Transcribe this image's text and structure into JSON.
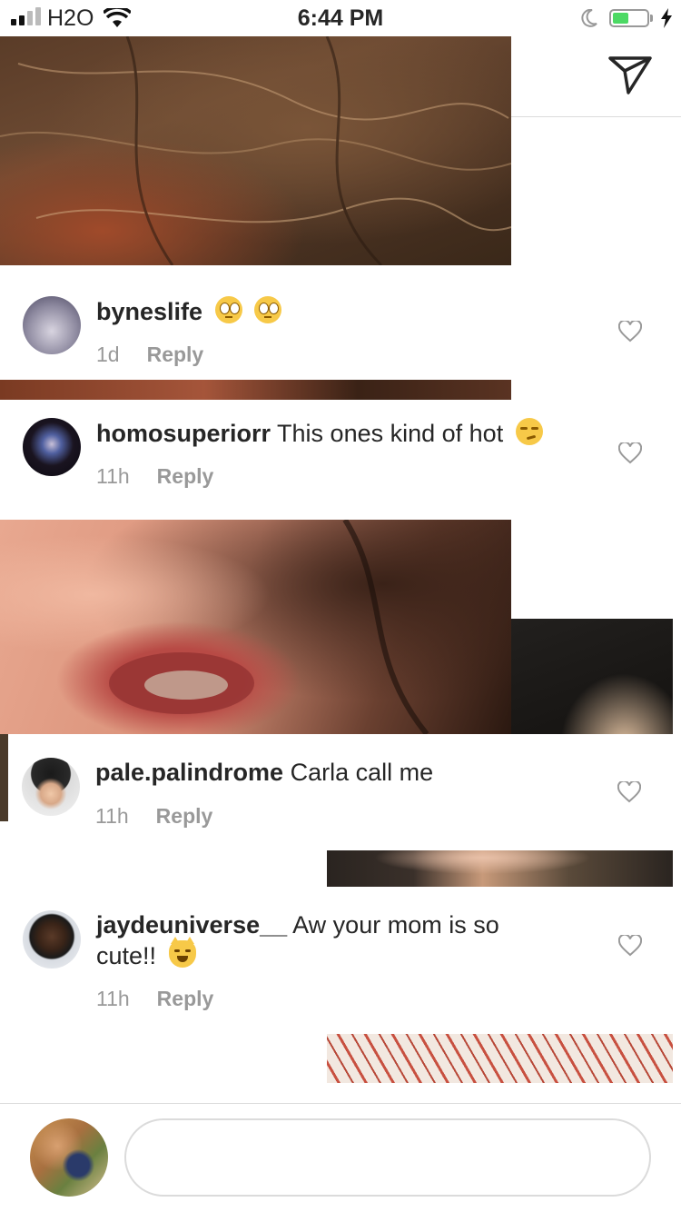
{
  "status_bar": {
    "carrier": "H2O",
    "time": "6:44 PM"
  },
  "comments": [
    {
      "username": "byneslife",
      "text": "",
      "emoji": [
        "rolling-eyes-emoji",
        "rolling-eyes-emoji"
      ],
      "time": "1d",
      "reply_label": "Reply"
    },
    {
      "username": "homosuperiorr",
      "text": "This ones kind of hot",
      "emoji": [
        "smirk-emoji"
      ],
      "time": "11h",
      "reply_label": "Reply"
    },
    {
      "username": "pale.palindrome",
      "text": "Carla call me",
      "emoji": [],
      "time": "11h",
      "reply_label": "Reply"
    },
    {
      "username": "jaydeuniverse__",
      "text": "Aw your mom is so",
      "text_line2": "cute!!",
      "emoji": [
        "smiling-cat-emoji"
      ],
      "time": "11h",
      "reply_label": "Reply"
    }
  ],
  "comment_input": {
    "placeholder": ""
  },
  "colors": {
    "accent": "#262626",
    "muted": "#999999",
    "battery": "#4cd964"
  }
}
